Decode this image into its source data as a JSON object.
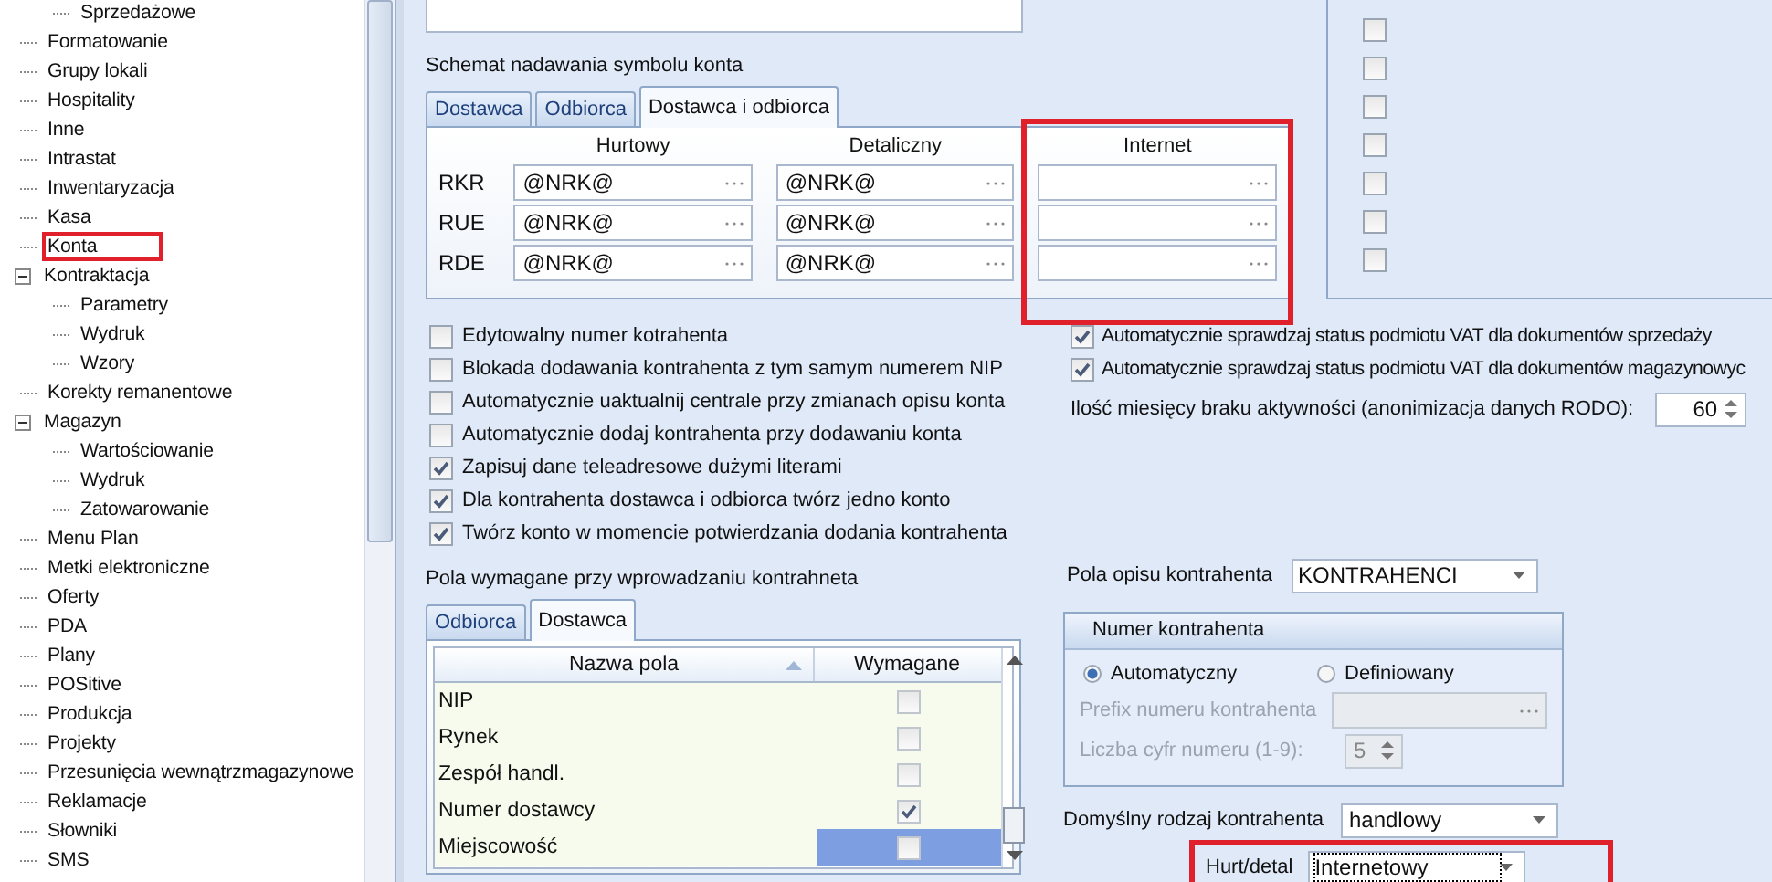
{
  "sidebar": {
    "tree": [
      {
        "children": [
          {
            "label": "Sprzedażowe",
            "highlighted": false
          }
        ]
      },
      {
        "label": "Formatowanie",
        "highlighted": false
      },
      {
        "label": "Grupy lokali",
        "highlighted": false
      },
      {
        "label": "Hospitality",
        "highlighted": false
      },
      {
        "label": "Inne",
        "highlighted": false
      },
      {
        "label": "Intrastat",
        "highlighted": false
      },
      {
        "label": "Inwentaryzacja",
        "highlighted": false
      },
      {
        "label": "Kasa",
        "highlighted": false
      },
      {
        "label": "Konta",
        "highlighted": true
      },
      {
        "label": "Kontraktacja",
        "highlighted": false,
        "expanded": true,
        "children": [
          {
            "label": "Parametry",
            "highlighted": false
          },
          {
            "label": "Wydruk",
            "highlighted": false
          },
          {
            "label": "Wzory",
            "highlighted": false
          }
        ]
      },
      {
        "label": "Korekty remanentowe",
        "highlighted": false
      },
      {
        "label": "Magazyn",
        "highlighted": false,
        "expanded": true,
        "children": [
          {
            "label": "Wartościowanie",
            "highlighted": false
          },
          {
            "label": "Wydruk",
            "highlighted": false
          },
          {
            "label": "Zatowarowanie",
            "highlighted": false
          }
        ]
      },
      {
        "label": "Menu Plan",
        "highlighted": false
      },
      {
        "label": "Metki elektroniczne",
        "highlighted": false
      },
      {
        "label": "Oferty",
        "highlighted": false
      },
      {
        "label": "PDA",
        "highlighted": false
      },
      {
        "label": "Plany",
        "highlighted": false
      },
      {
        "label": "POSitive",
        "highlighted": false
      },
      {
        "label": "Produkcja",
        "highlighted": false
      },
      {
        "label": "Projekty",
        "highlighted": false
      },
      {
        "label": "Przesunięcia wewnątrzmagazynowe",
        "highlighted": false
      },
      {
        "label": "Reklamacje",
        "highlighted": false
      },
      {
        "label": "Słowniki",
        "highlighted": false
      },
      {
        "label": "SMS",
        "highlighted": false
      }
    ]
  },
  "right_group": {
    "checkboxes": [
      {
        "checked": false
      },
      {
        "checked": false
      },
      {
        "checked": false
      },
      {
        "checked": false
      },
      {
        "checked": false
      },
      {
        "checked": false
      },
      {
        "checked": false
      }
    ]
  },
  "account_scheme": {
    "label": "Schemat nadawania symbolu konta",
    "tabs": [
      {
        "label": "Dostawca",
        "selected": false
      },
      {
        "label": "Odbiorca",
        "selected": false
      },
      {
        "label": "Dostawca i odbiorca",
        "selected": true
      }
    ],
    "columns": [
      {
        "header": "Hurtowy",
        "highlighted": false
      },
      {
        "header": "Detaliczny",
        "highlighted": false
      },
      {
        "header": "Internet",
        "highlighted": true
      }
    ],
    "rows": [
      {
        "label": "RKR",
        "cells": [
          {
            "value": "@NRK@"
          },
          {
            "value": "@NRK@"
          },
          {}
        ]
      },
      {
        "label": "RUE",
        "cells": [
          {
            "value": "@NRK@"
          },
          {
            "value": "@NRK@"
          },
          {}
        ]
      },
      {
        "label": "RDE",
        "cells": [
          {
            "value": "@NRK@"
          },
          {
            "value": "@NRK@"
          },
          {}
        ]
      }
    ]
  },
  "options": [
    {
      "label": "Edytowalny numer kotrahenta",
      "checked": false
    },
    {
      "label": "Blokada dodawania kontrahenta z tym samym numerem NIP",
      "checked": false
    },
    {
      "label": "Automatycznie uaktualnij centrale przy zmianach opisu konta",
      "checked": false
    },
    {
      "label": "Automatycznie dodaj kontrahenta przy dodawaniu konta",
      "checked": false
    },
    {
      "label": "Zapisuj dane teleadresowe dużymi literami",
      "checked": true
    },
    {
      "label": "Dla kontrahenta dostawca i odbiorca twórz jedno konto",
      "checked": true
    },
    {
      "label": "Twórz konto w momencie potwierdzania dodania kontrahenta",
      "checked": true
    }
  ],
  "vat_options": [
    {
      "label": "Automatycznie sprawdzaj status podmiotu VAT dla dokumentów sprzedaży",
      "checked": true
    },
    {
      "label": "Automatycznie sprawdzaj status podmiotu VAT dla dokumentów magazynowyc",
      "checked": true
    }
  ],
  "rodo": {
    "label": "Ilość miesięcy braku aktywności (anonimizacja danych RODO):",
    "value": "60"
  },
  "required_fields": {
    "label": "Pola wymagane przy wprowadzaniu kontrahneta",
    "tabs": [
      {
        "label": "Odbiorca",
        "selected": false
      },
      {
        "label": "Dostawca",
        "selected": true
      }
    ],
    "columns": [
      "Nazwa pola",
      "Wymagane"
    ],
    "rows": [
      {
        "name": "NIP",
        "required": false,
        "selected": false
      },
      {
        "name": "Rynek",
        "required": false,
        "selected": false
      },
      {
        "name": "Zespół handl.",
        "required": false,
        "selected": false
      },
      {
        "name": "Numer dostawcy",
        "required": true,
        "selected": false
      },
      {
        "name": "Miejscowość",
        "required": false,
        "selected": true
      }
    ]
  },
  "description_fields": {
    "label": "Pola opisu kontrahenta",
    "value": "KONTRAHENCI"
  },
  "number_group": {
    "title": "Numer kontrahenta",
    "radios": [
      {
        "label": "Automatyczny",
        "selected": true
      },
      {
        "label": "Definiowany",
        "selected": false
      }
    ],
    "prefix": {
      "label": "Prefix numeru kontrahenta",
      "disabled": true
    },
    "digits": {
      "label": "Liczba cyfr numeru (1-9):",
      "value": "5",
      "disabled": true
    }
  },
  "default_type": {
    "label": "Domyślny rodzaj kontrahenta",
    "value": "handlowy"
  },
  "wholesale_retail": {
    "label": "Hurt/detal",
    "value": "Internetowy",
    "highlighted": true,
    "focused": true
  }
}
